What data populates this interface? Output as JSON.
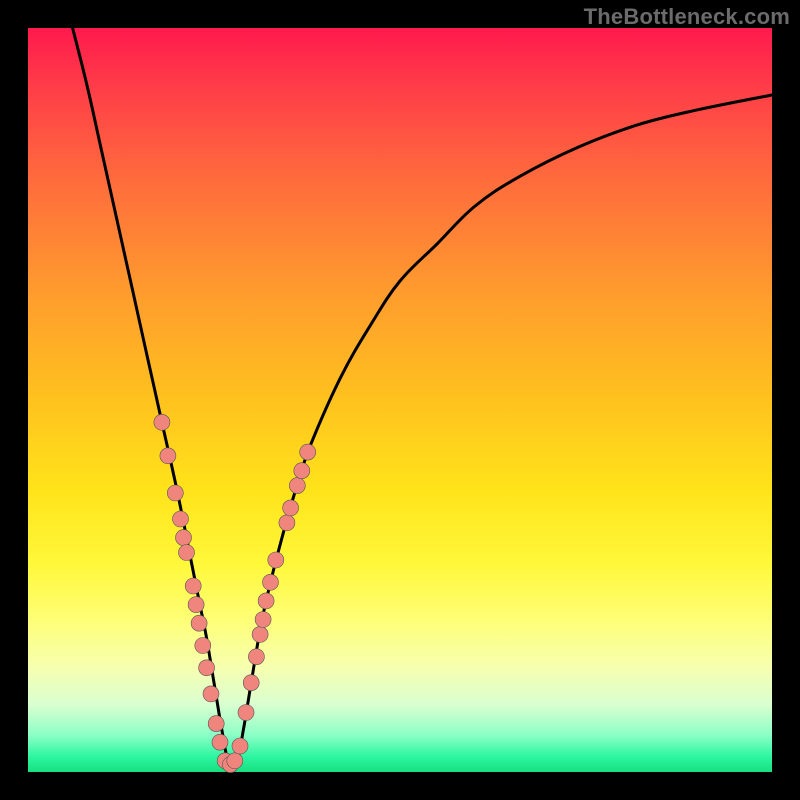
{
  "watermark": "TheBottleneck.com",
  "colors": {
    "curve": "#000000",
    "marker_fill": "#f0857d",
    "marker_stroke": "#555555",
    "gradient_top": "#ff1a4d",
    "gradient_bottom": "#16e07e",
    "background": "#000000"
  },
  "chart_data": {
    "type": "line",
    "title": "",
    "xlabel": "",
    "ylabel": "",
    "xlim": [
      0,
      100
    ],
    "ylim": [
      0,
      100
    ],
    "grid": false,
    "x_at_minimum": 27,
    "series": [
      {
        "name": "bottleneck-curve",
        "x": [
          6,
          8,
          10,
          12,
          14,
          16,
          18,
          20,
          22,
          23,
          24,
          25,
          26,
          27,
          28,
          29,
          30,
          31,
          32,
          34,
          36,
          38,
          42,
          46,
          50,
          55,
          60,
          66,
          74,
          82,
          90,
          100
        ],
        "y": [
          100,
          92,
          83,
          74,
          65,
          56,
          47,
          38,
          28,
          23,
          18,
          12,
          6,
          1,
          1,
          6,
          12,
          18,
          23,
          31,
          38,
          44,
          53,
          60,
          66,
          71,
          76,
          80,
          84,
          87,
          89,
          91
        ]
      }
    ],
    "markers": [
      {
        "x": 18.0,
        "y": 47.0
      },
      {
        "x": 18.8,
        "y": 42.5
      },
      {
        "x": 19.8,
        "y": 37.5
      },
      {
        "x": 20.5,
        "y": 34.0
      },
      {
        "x": 20.9,
        "y": 31.5
      },
      {
        "x": 21.3,
        "y": 29.5
      },
      {
        "x": 22.2,
        "y": 25.0
      },
      {
        "x": 22.6,
        "y": 22.5
      },
      {
        "x": 23.0,
        "y": 20.0
      },
      {
        "x": 23.5,
        "y": 17.0
      },
      {
        "x": 24.0,
        "y": 14.0
      },
      {
        "x": 24.6,
        "y": 10.5
      },
      {
        "x": 25.3,
        "y": 6.5
      },
      {
        "x": 25.8,
        "y": 4.0
      },
      {
        "x": 26.5,
        "y": 1.5
      },
      {
        "x": 27.2,
        "y": 1.0
      },
      {
        "x": 27.8,
        "y": 1.5
      },
      {
        "x": 28.5,
        "y": 3.5
      },
      {
        "x": 29.3,
        "y": 8.0
      },
      {
        "x": 30.0,
        "y": 12.0
      },
      {
        "x": 30.7,
        "y": 15.5
      },
      {
        "x": 31.2,
        "y": 18.5
      },
      {
        "x": 31.6,
        "y": 20.5
      },
      {
        "x": 32.0,
        "y": 23.0
      },
      {
        "x": 32.6,
        "y": 25.5
      },
      {
        "x": 33.3,
        "y": 28.5
      },
      {
        "x": 34.8,
        "y": 33.5
      },
      {
        "x": 35.3,
        "y": 35.5
      },
      {
        "x": 36.2,
        "y": 38.5
      },
      {
        "x": 36.8,
        "y": 40.5
      },
      {
        "x": 37.6,
        "y": 43.0
      }
    ]
  }
}
